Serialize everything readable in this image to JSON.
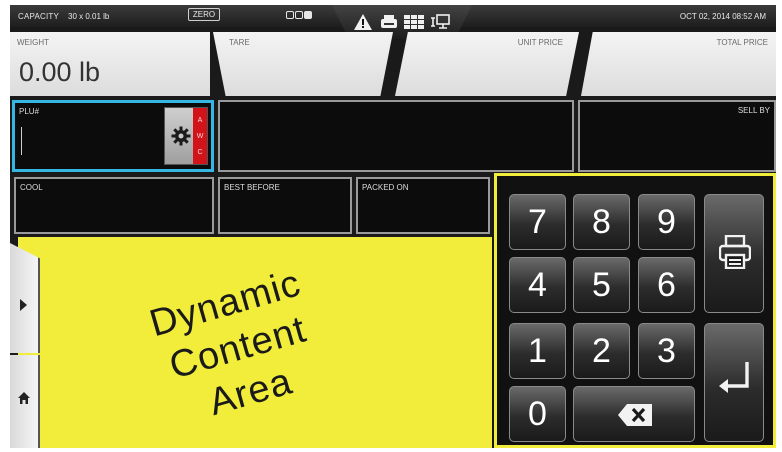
{
  "status_bar": {
    "capacity_label": "CAPACITY",
    "capacity_value": "30 x 0.01 lb",
    "zero_label": "ZERO",
    "datetime": "OCT 02, 2014 08:52 AM",
    "icons": [
      "warning-icon",
      "printer-icon",
      "grid-icon",
      "network-icon"
    ]
  },
  "weight_row": {
    "weight_label": "WEIGHT",
    "weight_value": "0.00 lb",
    "tare_label": "TARE",
    "unit_price_label": "UNIT PRICE",
    "total_price_label": "TOTAL PRICE"
  },
  "plu_row": {
    "plu_label": "PLU#",
    "mode_letters": [
      "A",
      "W",
      "C"
    ],
    "sell_by_label": "SELL BY"
  },
  "dates_row": {
    "cool_label": "COOL",
    "best_before_label": "BEST BEFORE",
    "packed_on_label": "PACKED ON"
  },
  "dynamic_area": {
    "line1": "Dynamic",
    "line2": "Content",
    "line3": "Area"
  },
  "keypad": {
    "keys": [
      "7",
      "8",
      "9",
      "4",
      "5",
      "6",
      "1",
      "2",
      "3",
      "0"
    ]
  },
  "colors": {
    "accent_blue": "#35b6e3",
    "dynamic_yellow": "#f1ed3a",
    "mode_red": "#d0141a"
  }
}
